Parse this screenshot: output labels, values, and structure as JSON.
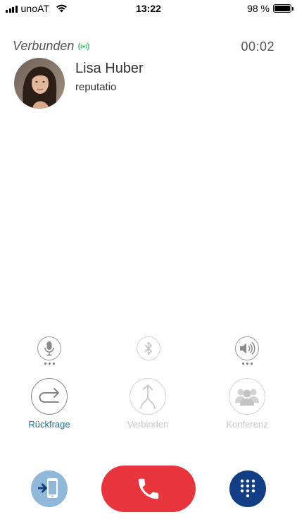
{
  "status_bar": {
    "carrier": "unoAT",
    "time": "13:22",
    "battery_percent": "98 %",
    "battery_level": 0.98
  },
  "call": {
    "state_label": "Verbunden",
    "timer": "00:02"
  },
  "contact": {
    "name": "Lisa Huber",
    "company": "reputatio"
  },
  "controls": {
    "audio": [
      {
        "icon": "microphone-icon",
        "enabled": true
      },
      {
        "icon": "bluetooth-icon",
        "enabled": false
      },
      {
        "icon": "speaker-icon",
        "enabled": true
      }
    ],
    "actions": [
      {
        "label": "Rückfrage",
        "icon": "consult-call-icon",
        "enabled": true
      },
      {
        "label": "Verbinden",
        "icon": "merge-icon",
        "enabled": false
      },
      {
        "label": "Konferenz",
        "icon": "conference-icon",
        "enabled": false
      }
    ]
  },
  "bottom_bar": {
    "transfer_icon": "transfer-to-phone-icon",
    "hangup_icon": "end-call-icon",
    "keypad_icon": "dialpad-icon"
  },
  "colors": {
    "accent_teal": "#1e6e86",
    "hangup_red": "#e8343d",
    "keypad_navy": "#123e85",
    "transfer_blue": "#8fb8d9",
    "connected_green": "#3cc36a"
  }
}
